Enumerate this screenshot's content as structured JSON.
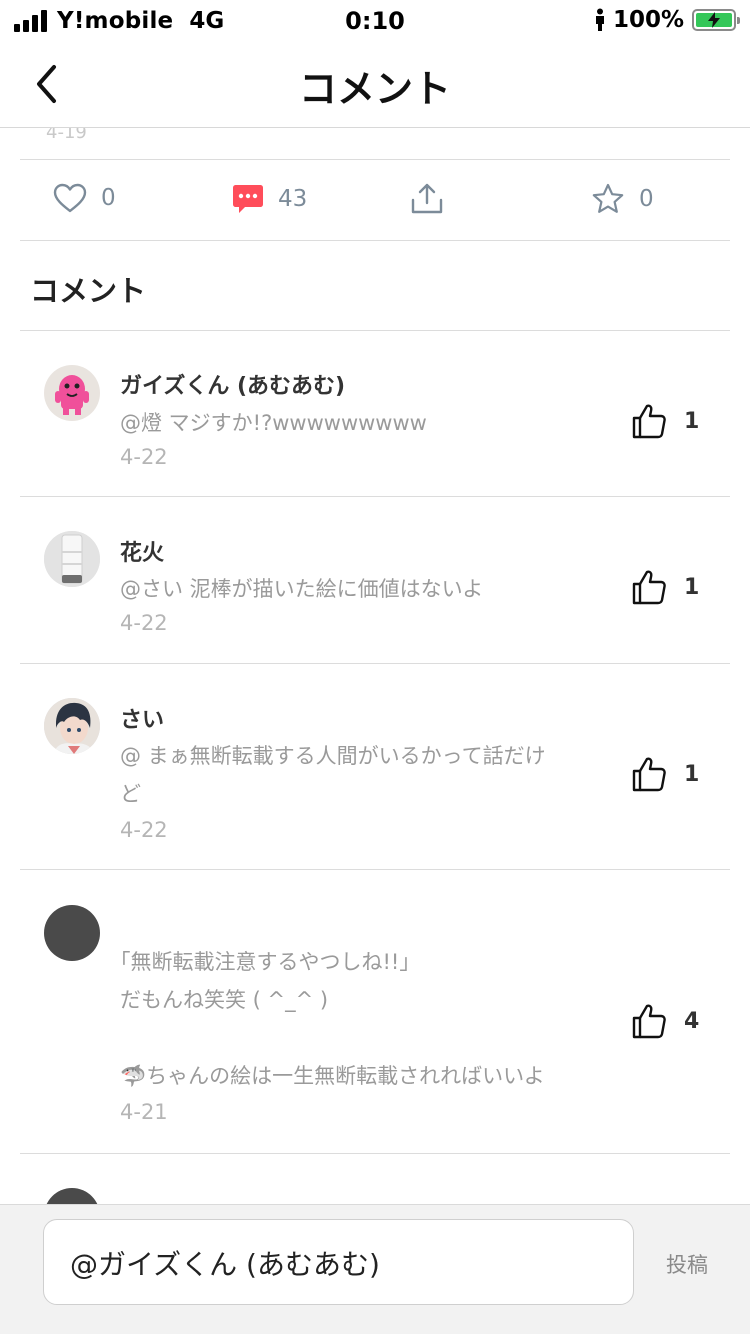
{
  "status_bar": {
    "carrier": "Y!mobile",
    "network": "4G",
    "time": "0:10",
    "battery": "100%"
  },
  "nav": {
    "title": "コメント",
    "back_icon": "chevron-left-icon"
  },
  "partial_text": "4-19",
  "actions": {
    "like_count": "0",
    "comment_count": "43",
    "favorite_count": "0",
    "comment_icon_color": "#ff4d5a"
  },
  "section_title": "コメント",
  "comments": [
    {
      "name": "ガイズくん (あむあむ)",
      "text": "@燈 マジすか!?wwwwwwwww",
      "date": "4-22",
      "likes": "1"
    },
    {
      "name": "花火",
      "text": "@さい 泥棒が描いた絵に価値はないよ",
      "date": "4-22",
      "likes": "1"
    },
    {
      "name": "さい",
      "text_line1": "@ まぁ無断転載する人間がいるかって話だけ",
      "text_line2": "ど",
      "date": "4-22",
      "likes": "1"
    },
    {
      "name": "",
      "text_line1": "｢無断転載注意するやつしね!!｣",
      "text_line2": "だもんね笑笑 ( ^_^ )",
      "text_line3": "🦈ちゃんの絵は一生無断転載されればいいよ",
      "date": "4-21",
      "likes": "4"
    }
  ],
  "input": {
    "value": "@ガイズくん (あむあむ)",
    "post_label": "投稿"
  }
}
